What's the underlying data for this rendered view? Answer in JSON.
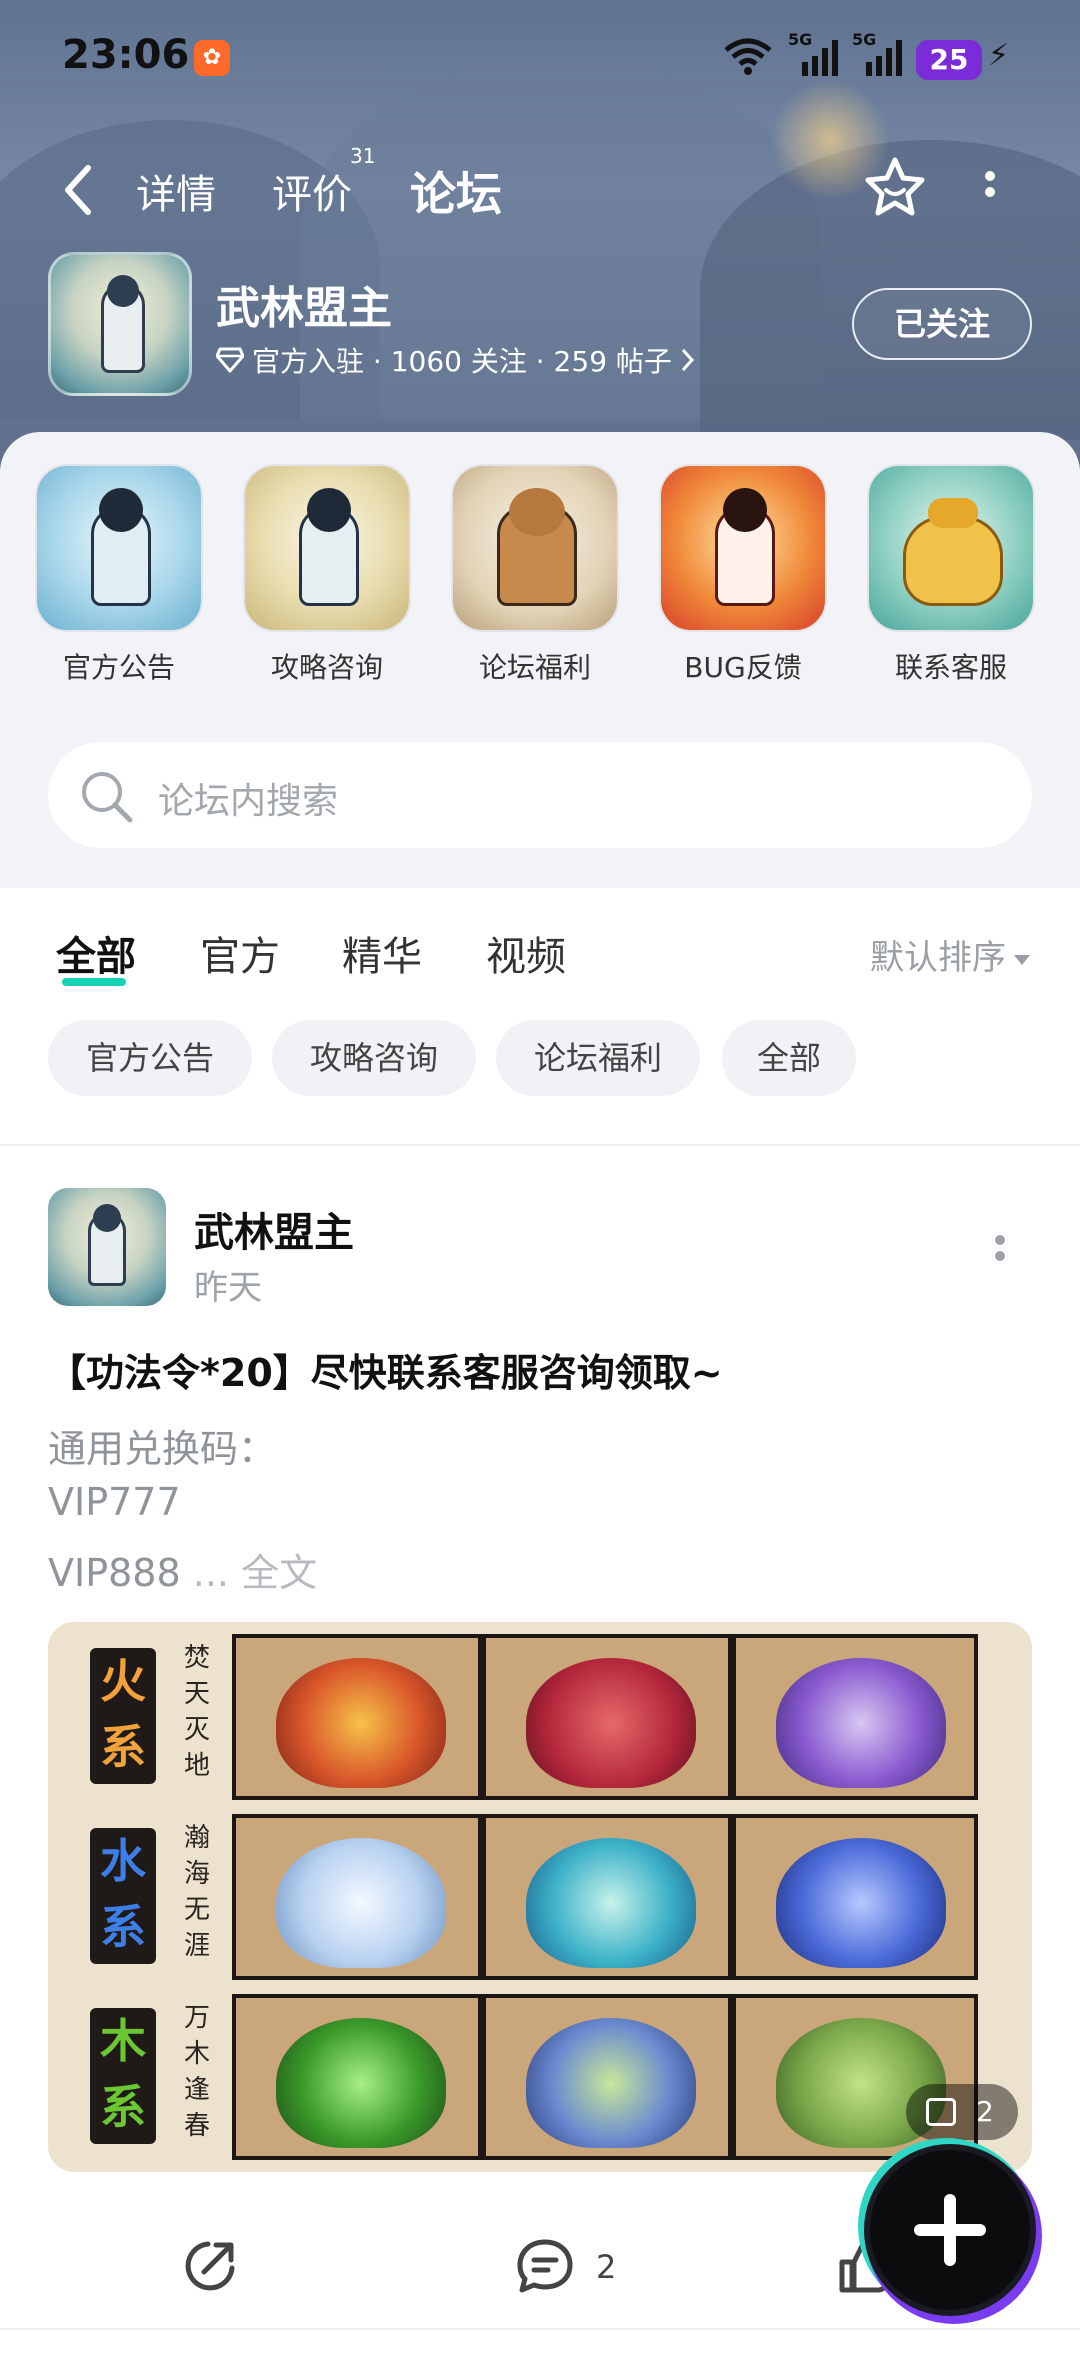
{
  "status_bar": {
    "time": "23:06",
    "network_label_1": "5G",
    "network_label_2": "5G",
    "battery": "25"
  },
  "nav": {
    "tabs": [
      "详情",
      "评价",
      "论坛"
    ],
    "review_count": "31",
    "active_tab": "论坛"
  },
  "forum": {
    "name": "武林盟主",
    "meta": "官方入驻 · 1060 关注 · 259 帖子",
    "follow_label": "已关注"
  },
  "categories": [
    {
      "label": "官方公告"
    },
    {
      "label": "攻略咨询"
    },
    {
      "label": "论坛福利"
    },
    {
      "label": "BUG反馈"
    },
    {
      "label": "联系客服"
    }
  ],
  "search": {
    "placeholder": "论坛内搜索"
  },
  "filter_tabs": [
    "全部",
    "官方",
    "精华",
    "视频"
  ],
  "sort_label": "默认排序",
  "chips": [
    "官方公告",
    "攻略咨询",
    "论坛福利",
    "全部"
  ],
  "post": {
    "author": "武林盟主",
    "time": "昨天",
    "title": "【功法令*20】尽快联系客服咨询领取~",
    "lines": [
      "通用兑换码：",
      "VIP777",
      "VIP888"
    ],
    "ellipsis": " ... ",
    "full_text_label": "全文",
    "image_rows": [
      {
        "label": "火系",
        "sub": "焚天灭地"
      },
      {
        "label": "水系",
        "sub": "瀚海无涯"
      },
      {
        "label": "木系",
        "sub": "万木逢春"
      }
    ],
    "image_count": "2",
    "comment_count": "2"
  },
  "colors": {
    "accent": "#17d3b6",
    "battery": "#7b2bd8",
    "fire": "#f2a23a",
    "water": "#3d7ee8",
    "wood": "#6cc832"
  }
}
